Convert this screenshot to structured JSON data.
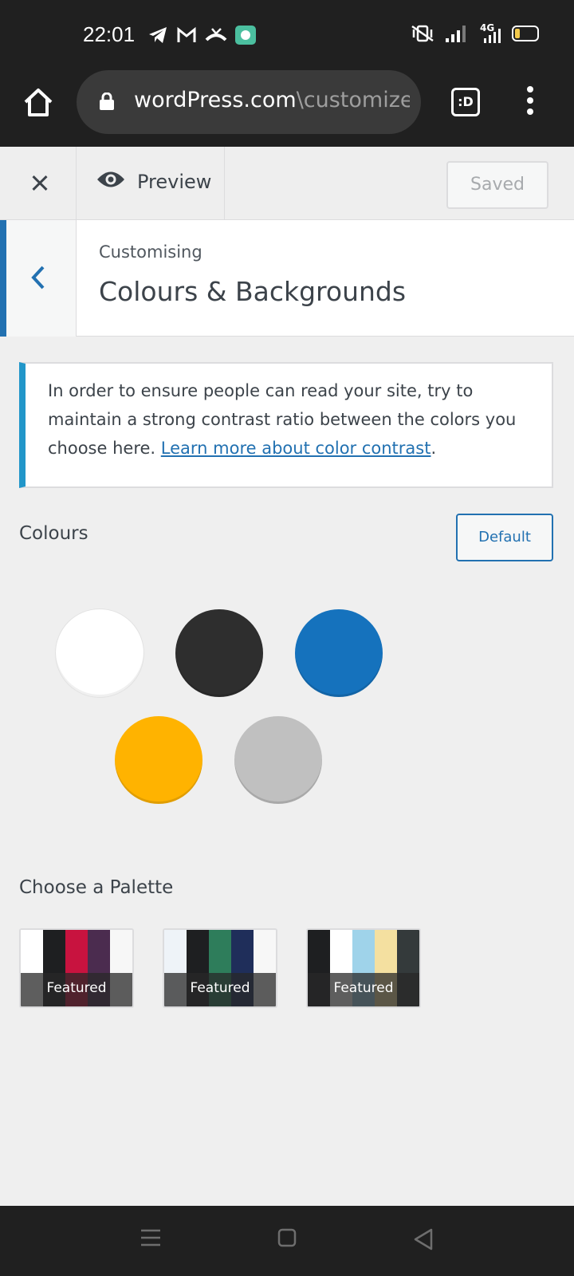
{
  "status_bar": {
    "time": "22:01",
    "left_icons": [
      "telegram-icon",
      "gmail-icon",
      "missed-call-icon",
      "app-notification-icon"
    ],
    "right_icons": [
      "vibrate-icon",
      "signal-icon",
      "4g-signal-icon",
      "battery-icon"
    ],
    "network_label": "4G"
  },
  "browser": {
    "url_host": "wordPress.com",
    "url_path": "\\customize\\es",
    "tabs_label": ":D"
  },
  "customizer": {
    "preview_label": "Preview",
    "saved_label": "Saved",
    "breadcrumb": "Customising",
    "section_title": "Colours & Backgrounds"
  },
  "notice": {
    "text": "In order to ensure people can read your site, try to maintain a strong contrast ratio between the colors you choose here. ",
    "link_text": "Learn more about color contrast",
    "after_link": "."
  },
  "colours": {
    "label": "Colours",
    "default_label": "Default",
    "swatches": [
      "#ffffff",
      "#2e2e2e",
      "#1572bd",
      "#ffb300",
      "#c0c0c0"
    ]
  },
  "palettes": {
    "label": "Choose a Palette",
    "items": [
      {
        "badge": "Featured",
        "colors": [
          "#ffffff",
          "#1e1f21",
          "#c8133f",
          "#4b2c4f",
          "#f7f7f7"
        ]
      },
      {
        "badge": "Featured",
        "colors": [
          "#eef3f8",
          "#1e1f21",
          "#2e7d5b",
          "#1f2e5a",
          "#f7f7f7"
        ]
      },
      {
        "badge": "Featured",
        "colors": [
          "#1e1f21",
          "#ffffff",
          "#9fd3ea",
          "#f4e0a0",
          "#343a3b"
        ]
      }
    ]
  },
  "nav_bar": {
    "items": [
      "recents-icon",
      "home-square-icon",
      "back-triangle-icon"
    ]
  },
  "theme": {
    "accent": "#2271b1",
    "notice_border": "#2196c9",
    "dark_chrome": "#202020"
  }
}
